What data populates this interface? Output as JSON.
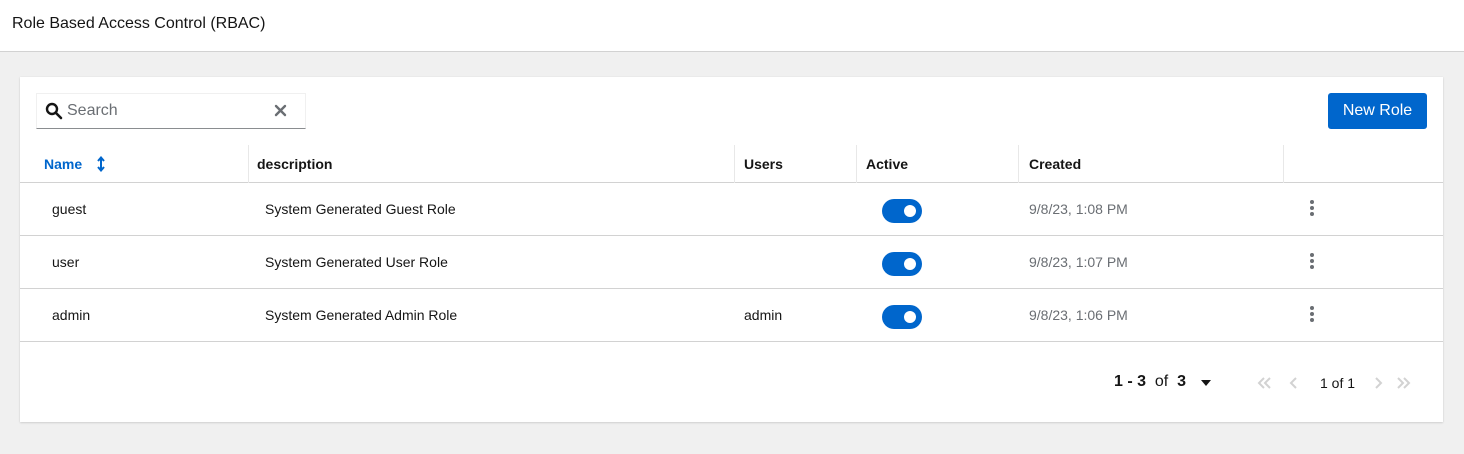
{
  "page": {
    "title": "Role Based Access Control (RBAC)"
  },
  "toolbar": {
    "search_placeholder": "Search",
    "new_role_label": "New Role"
  },
  "table": {
    "columns": [
      "Name",
      "description",
      "Users",
      "Active",
      "Created"
    ],
    "rows": [
      {
        "name": "guest",
        "description": "System Generated Guest Role",
        "users": "",
        "active": true,
        "created": "9/8/23, 1:08 PM"
      },
      {
        "name": "user",
        "description": "System Generated User Role",
        "users": "",
        "active": true,
        "created": "9/8/23, 1:07 PM"
      },
      {
        "name": "admin",
        "description": "System Generated Admin Role",
        "users": "admin",
        "active": true,
        "created": "9/8/23, 1:06 PM"
      }
    ]
  },
  "pagination": {
    "range": "1 - 3",
    "of_label": "of",
    "total": "3",
    "page_of": "1 of 1"
  },
  "colors": {
    "accent": "#0066cc",
    "border": "#d2d2d2",
    "background": "#f0f0f0"
  },
  "icons": [
    "search-icon",
    "close-icon",
    "sort-icon",
    "kebab-icon",
    "caret-down-icon",
    "first-page-icon",
    "previous-page-icon",
    "next-page-icon",
    "last-page-icon"
  ]
}
